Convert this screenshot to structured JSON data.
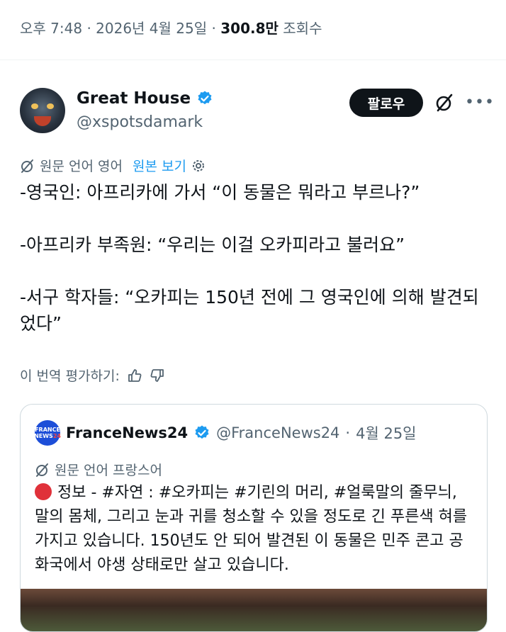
{
  "meta": {
    "time": "오후 7:48",
    "date": "2026년 4월 25일",
    "views_count": "300.8만",
    "views_label": "조회수"
  },
  "author": {
    "name": "Great House",
    "handle": "@xspotsdamark",
    "follow_label": "팔로우"
  },
  "translation": {
    "note": "원문 언어 영어",
    "show_original": "원본 보기"
  },
  "tweet": {
    "lines": [
      "-영국인: 아프리카에 가서 “이 동물은 뭐라고 부르나?”",
      "-아프리카 부족원: “우리는 이걸 오카피라고 불러요”",
      "-서구 학자들: “오카피는 150년 전에 그 영국인에 의해 발견되었다”"
    ]
  },
  "rating": {
    "label": "이 번역 평가하기:"
  },
  "quote": {
    "logo_line1": "FRANCE",
    "logo_line2": "NEWS",
    "logo_line3": "24",
    "name": "FranceNews24",
    "handle": "@FranceNews24",
    "date": "4월 25일",
    "translation_note": "원문 언어 프랑스어",
    "text": "정보 - #자연 : #오카피는 #기린의 머리, #얼룩말의 줄무늬, 말의 몸체, 그리고 눈과 귀를 청소할 수 있을 정도로 긴 푸른색 혀를 가지고 있습니다. 150년도 안 되어 발견된 이 동물은 민주 콘고 공화국에서 야생 상태로만 살고 있습니다."
  },
  "colors": {
    "verified": "#1d9bf0",
    "link": "#1d9bf0",
    "secondary_text": "#536471",
    "alert_dot": "#e0313a"
  },
  "icons": [
    "verified-badge-icon",
    "grok-icon",
    "more-icon",
    "translate-icon",
    "settings-icon",
    "thumbs-up-icon",
    "thumbs-down-icon",
    "red-circle-icon"
  ]
}
